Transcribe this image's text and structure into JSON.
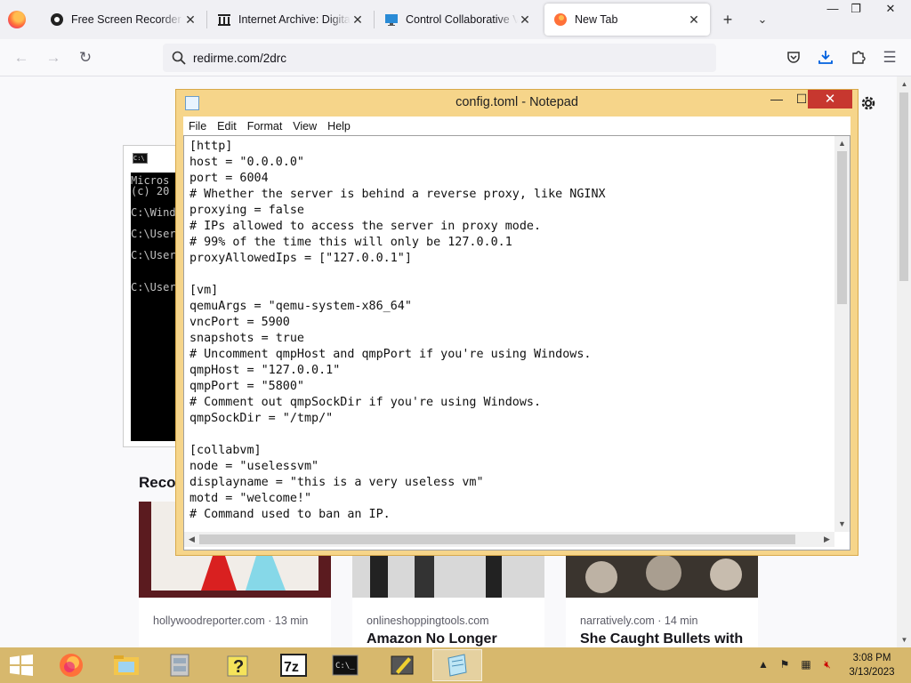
{
  "browser": {
    "tabs": [
      {
        "label": "Free Screen Recorder - N",
        "icon": "recorder-icon"
      },
      {
        "label": "Internet Archive: Digital L",
        "icon": "archive-icon"
      },
      {
        "label": "Control Collaborative Vir",
        "icon": "monitor-icon"
      },
      {
        "label": "New Tab",
        "icon": "firefox-icon",
        "active": true
      }
    ],
    "url": "redirme.com/2drc"
  },
  "page": {
    "recommended_heading": "Recom",
    "cmd_lines": "Micros\n(c) 20\n\nC:\\Wind\n\nC:\\User\n\nC:\\User\n\n\nC:\\User",
    "cards": [
      {
        "source": "hollywoodreporter.com · 13 min",
        "headline": ""
      },
      {
        "source": "onlineshoppingtools.com",
        "headline": "Amazon No Longer"
      },
      {
        "source": "narratively.com · 14 min",
        "headline": "She Caught Bullets with"
      }
    ]
  },
  "notepad": {
    "title": "config.toml - Notepad",
    "menu": [
      "File",
      "Edit",
      "Format",
      "View",
      "Help"
    ],
    "content": "[http]\nhost = \"0.0.0.0\"\nport = 6004\n# Whether the server is behind a reverse proxy, like NGINX\nproxying = false\n# IPs allowed to access the server in proxy mode.\n# 99% of the time this will only be 127.0.0.1\nproxyAllowedIps = [\"127.0.0.1\"]\n\n[vm]\nqemuArgs = \"qemu-system-x86_64\"\nvncPort = 5900\nsnapshots = true\n# Uncomment qmpHost and qmpPort if you're using Windows.\nqmpHost = \"127.0.0.1\"\nqmpPort = \"5800\"\n# Comment out qmpSockDir if you're using Windows.\nqmpSockDir = \"/tmp/\"\n\n[collabvm]\nnode = \"uselessvm\"\ndisplayname = \"this is a very useless vm\"\nmotd = \"welcome!\"\n# Command used to ban an IP."
  },
  "taskbar": {
    "apps": [
      "firefox",
      "file-explorer",
      "archive-manager",
      "help",
      "7zip",
      "command-prompt",
      "paint",
      "notepad"
    ],
    "clock_time": "3:08 PM",
    "clock_date": "3/13/2023"
  },
  "colors": {
    "notepad_frame": "#f6d58a",
    "taskbar": "#d7b86d",
    "close_red": "#c7372f"
  }
}
